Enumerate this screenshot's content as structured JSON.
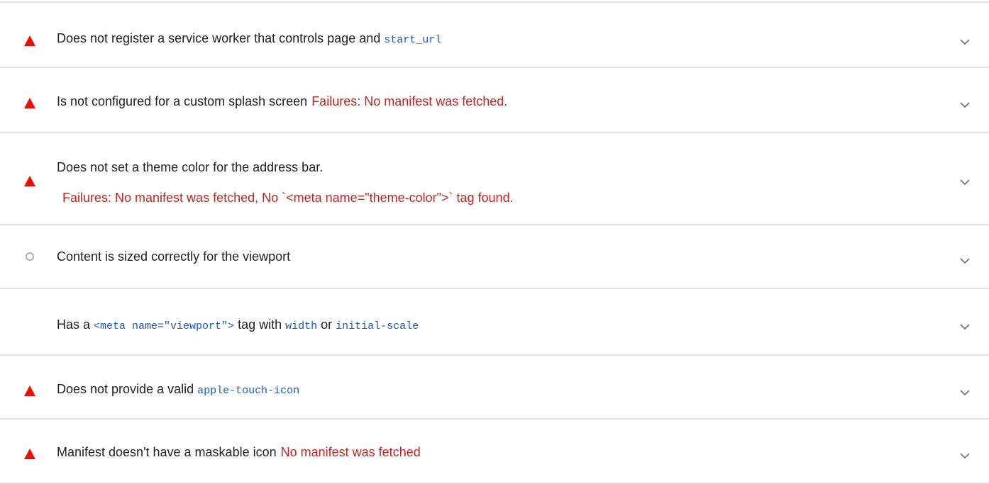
{
  "audits": [
    {
      "status": "fail",
      "title_before": "Does not register a service worker that controls page and ",
      "code": "start_url"
    },
    {
      "status": "fail",
      "title": "Is not configured for a custom splash screen",
      "failure": "Failures: No manifest was fetched."
    },
    {
      "status": "fail",
      "title": "Does not set a theme color for the address bar.",
      "failure": "Failures: No manifest was fetched, No `<meta name=\"theme-color\">` tag found."
    },
    {
      "status": "manual",
      "title": "Content is sized correctly for the viewport"
    },
    {
      "status": "none",
      "title_before": "Has a ",
      "code1": "<meta name=\"viewport\">",
      "title_mid1": " tag with ",
      "code2": "width",
      "title_mid2": " or ",
      "code3": "initial-scale"
    },
    {
      "status": "fail",
      "title_before": "Does not provide a valid ",
      "code": "apple-touch-icon"
    },
    {
      "status": "fail",
      "title": "Manifest doesn't have a maskable icon",
      "failure": "No manifest was fetched"
    }
  ],
  "icons": {
    "fail": "warning-triangle-icon",
    "manual": "circle-icon",
    "expand": "chevron-down-icon"
  },
  "colors": {
    "fail": "#eb0f00",
    "failure_text": "#c5221f",
    "code": "#1a56c9",
    "divider": "#e0e0e0"
  }
}
